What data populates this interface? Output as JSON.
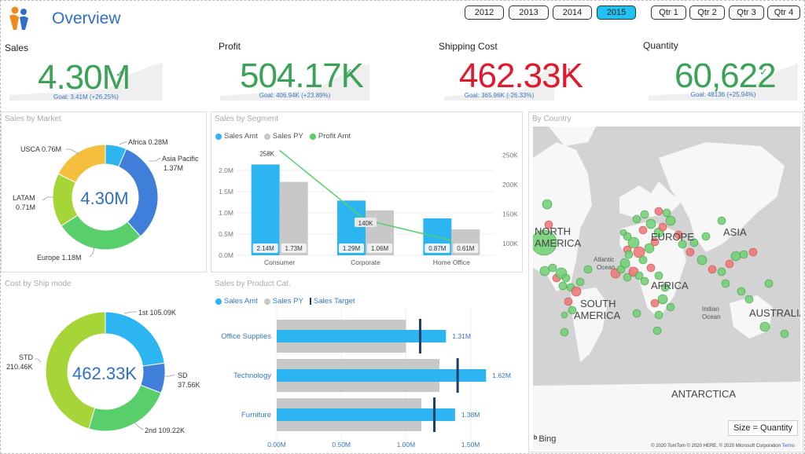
{
  "header": {
    "title": "Overview",
    "years": [
      "2012",
      "2013",
      "2014",
      "2015"
    ],
    "active_year": "2015",
    "quarters": [
      "Qtr 1",
      "Qtr 2",
      "Qtr 3",
      "Qtr 4"
    ],
    "accent_color": "#22c1f3"
  },
  "kpis": [
    {
      "label": "Sales",
      "value": "4.30M",
      "mark": "✓",
      "goal": "Goal: 3.41M (+26.25%)",
      "status": "green"
    },
    {
      "label": "Profit",
      "value": "504.17K",
      "mark": "✓",
      "goal": "Goal: 406.94K (+23.89%)",
      "status": "green"
    },
    {
      "label": "Shipping Cost",
      "value": "462.33K",
      "mark": "!",
      "goal": "Goal: 365.96K (-26.33%)",
      "status": "red"
    },
    {
      "label": "Quantity",
      "value": "60,622",
      "mark": "✓",
      "goal": "Goal: 48136 (+25.94%)",
      "status": "green"
    }
  ],
  "sales_by_market": {
    "title": "Sales by Market",
    "center": "4.30M",
    "labels": {
      "africa": "Africa 0.28M",
      "asia_1": "Asia Pacific",
      "asia_2": "1.37M",
      "usca": "USCA 0.76M",
      "latam_1": "LATAM",
      "latam_2": "0.71M",
      "europe": "Europe 1.18M"
    }
  },
  "cost_by_ship_mode": {
    "title": "Cost by Ship mode",
    "center": "462.33K",
    "labels": {
      "first": "1st 105.09K",
      "std_1": "STD",
      "std_2": "210.46K",
      "sd_1": "SD",
      "sd_2": "37.56K",
      "second": "2nd 109.22K"
    }
  },
  "sales_by_segment": {
    "title": "Sales by Segment",
    "legend": [
      "Sales Amt",
      "Sales PY",
      "Profit Amt"
    ],
    "y_left_ticks": [
      "2.0M",
      "1.5M",
      "1.0M",
      "0.5M",
      "0.0M"
    ],
    "y_right_ticks": [
      "250K",
      "200K",
      "150K",
      "100K"
    ],
    "categories": [
      "Consumer",
      "Corporate",
      "Home Office"
    ],
    "sales_labels": [
      "2.14M",
      "1.29M",
      "0.87M"
    ],
    "py_labels": [
      "1.73M",
      "1.06M",
      "0.61M"
    ],
    "profit_labels": [
      "258K",
      "140K",
      ""
    ]
  },
  "sales_by_product": {
    "title": "Sales by Product Cat.",
    "legend": [
      "Sales Amt",
      "Sales PY",
      "Sales Target"
    ],
    "categories": [
      "Office Supplies",
      "Technology",
      "Furniture"
    ],
    "value_labels": [
      "1.31M",
      "1.62M",
      "1.38M"
    ],
    "x_ticks": [
      "0.00M",
      "0.50M",
      "1.00M",
      "1.50M"
    ]
  },
  "map": {
    "title": "By Country",
    "labels": {
      "north_1": "NORTH",
      "north_2": "AMERICA",
      "europe": "EUROPE",
      "asia": "ASIA",
      "africa": "AFRICA",
      "south_1": "SOUTH",
      "south_2": "AMERICA",
      "australia": "AUSTRALIA",
      "antarctica": "ANTARCTICA",
      "atlantic_1": "Atlantic",
      "atlantic_2": "Ocean",
      "indian_1": "Indian",
      "indian_2": "Ocean"
    },
    "size_legend": "Size = Quantity",
    "brand": "Bing",
    "copyright": "© 2020 TomTom © 2020 HERE, © 2020 Microsoft Corporation",
    "terms": "Terms"
  },
  "chart_data": [
    {
      "type": "pie",
      "title": "Sales by Market",
      "categories": [
        "Africa",
        "Asia Pacific",
        "Europe",
        "LATAM",
        "USCA"
      ],
      "values": [
        0.28,
        1.37,
        1.18,
        0.71,
        0.76
      ],
      "unit": "M",
      "colors": [
        "#2cb5f0",
        "#3f7fd9",
        "#58cf6b",
        "#a6d538",
        "#f4bf3d"
      ]
    },
    {
      "type": "pie",
      "title": "Cost by Ship mode",
      "categories": [
        "1st",
        "SD",
        "2nd",
        "STD"
      ],
      "values": [
        105.09,
        37.56,
        109.22,
        210.46
      ],
      "unit": "K",
      "colors": [
        "#2cb5f0",
        "#3f7fd9",
        "#58cf6b",
        "#a6d538"
      ]
    },
    {
      "type": "bar",
      "title": "Sales by Segment",
      "categories": [
        "Consumer",
        "Corporate",
        "Home Office"
      ],
      "series": [
        {
          "name": "Sales Amt",
          "values": [
            2.14,
            1.29,
            0.87
          ],
          "color": "#2cb5f0"
        },
        {
          "name": "Sales PY",
          "values": [
            1.73,
            1.06,
            0.61
          ],
          "color": "#c8c8c8"
        },
        {
          "name": "Profit Amt",
          "values": [
            258,
            140,
            105
          ],
          "color": "#58cf6b",
          "axis": "right"
        }
      ],
      "ylim": [
        0,
        2.5
      ],
      "y2lim": [
        80,
        260
      ]
    },
    {
      "type": "bar",
      "title": "Sales by Product Cat.",
      "orientation": "horizontal",
      "categories": [
        "Office Supplies",
        "Technology",
        "Furniture"
      ],
      "series": [
        {
          "name": "Sales Amt",
          "values": [
            1.31,
            1.62,
            1.38
          ],
          "color": "#2cb5f0"
        },
        {
          "name": "Sales PY",
          "values": [
            1.0,
            1.26,
            1.12
          ],
          "color": "#c8c8c8"
        },
        {
          "name": "Sales Target",
          "values": [
            1.11,
            1.4,
            1.22
          ],
          "color": "#1b3f66"
        }
      ],
      "xlim": [
        0,
        1.6
      ]
    },
    {
      "type": "scatter",
      "title": "By Country",
      "note": "bubble map; size = Quantity; green = above target, red = below target"
    }
  ]
}
